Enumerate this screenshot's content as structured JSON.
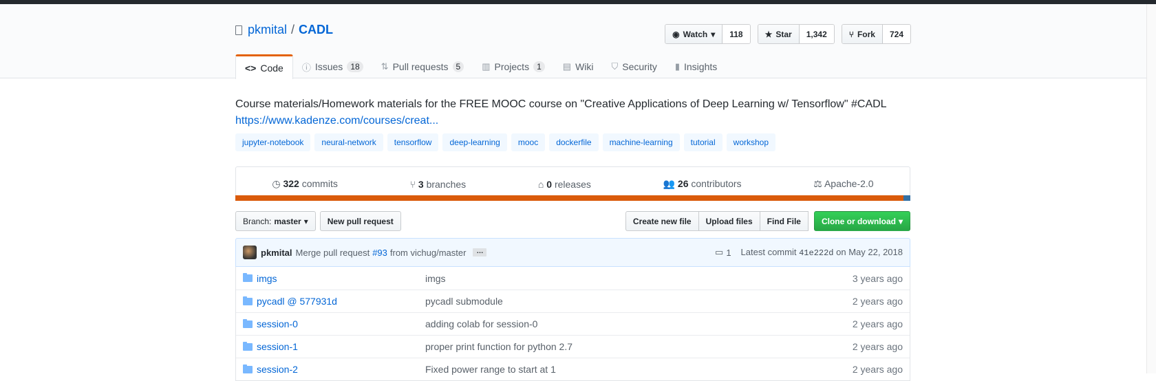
{
  "repo": {
    "owner": "pkmital",
    "separator": "/",
    "name": "CADL"
  },
  "actions": {
    "watch": {
      "label": "Watch",
      "count": "118"
    },
    "star": {
      "label": "Star",
      "count": "1,342"
    },
    "fork": {
      "label": "Fork",
      "count": "724"
    }
  },
  "tabs": [
    {
      "label": "Code",
      "count": null
    },
    {
      "label": "Issues",
      "count": "18"
    },
    {
      "label": "Pull requests",
      "count": "5"
    },
    {
      "label": "Projects",
      "count": "1"
    },
    {
      "label": "Wiki",
      "count": null
    },
    {
      "label": "Security",
      "count": null
    },
    {
      "label": "Insights",
      "count": null
    }
  ],
  "description": "Course materials/Homework materials for the FREE MOOC course on \"Creative Applications of Deep Learning w/ Tensorflow\" #CADL",
  "homepage": "https://www.kadenze.com/courses/creat...",
  "topics": [
    "jupyter-notebook",
    "neural-network",
    "tensorflow",
    "deep-learning",
    "mooc",
    "dockerfile",
    "machine-learning",
    "tutorial",
    "workshop"
  ],
  "summary": {
    "commits": {
      "n": "322",
      "label": "commits"
    },
    "branches": {
      "n": "3",
      "label": "branches"
    },
    "releases": {
      "n": "0",
      "label": "releases"
    },
    "contributors": {
      "n": "26",
      "label": "contributors"
    },
    "license": "Apache-2.0"
  },
  "languages": [
    {
      "color": "#DA5B0B",
      "share": 0.99
    },
    {
      "color": "#3572A5",
      "share": 0.01
    }
  ],
  "filebar": {
    "branch_prefix": "Branch:",
    "branch_name": "master",
    "new_pr": "New pull request",
    "create_file": "Create new file",
    "upload_files": "Upload files",
    "find_file": "Find File",
    "clone": "Clone or download"
  },
  "commit": {
    "author": "pkmital",
    "message_prefix": "Merge pull request",
    "pr_link": "#93",
    "message_suffix": "from vichug/master",
    "ellipsis": "…",
    "comments": "1",
    "latest_label": "Latest commit",
    "sha": "41e222d",
    "date": "on May 22, 2018"
  },
  "files": [
    {
      "name": "imgs",
      "message": "imgs",
      "age": "3 years ago"
    },
    {
      "name": "pycadl @ 577931d",
      "message": "pycadl submodule",
      "age": "2 years ago"
    },
    {
      "name": "session-0",
      "message": "adding colab for session-0",
      "age": "2 years ago"
    },
    {
      "name": "session-1",
      "message": "proper print function for python 2.7",
      "age": "2 years ago"
    },
    {
      "name": "session-2",
      "message": "Fixed power range to start at 1",
      "age": "2 years ago"
    }
  ]
}
